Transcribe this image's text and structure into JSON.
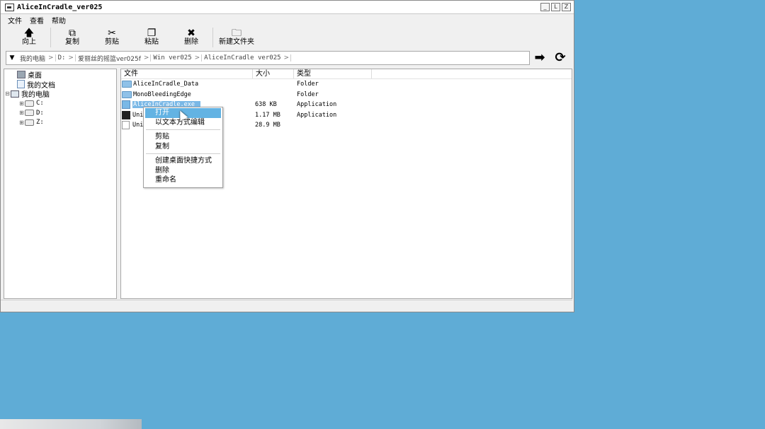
{
  "window": {
    "title": "AliceInCradle_ver025",
    "btn_min": "_",
    "btn_max": "L",
    "btn_close": "Z"
  },
  "menu": [
    "文件",
    "查看",
    "帮助"
  ],
  "toolbar": {
    "up": "向上",
    "copy": "复制",
    "cut": "剪贴",
    "paste": "粘贴",
    "delete": "删除",
    "new_folder": "新建文件夹"
  },
  "address": {
    "crumbs": [
      "我的电脑",
      "D:",
      "爱丽丝的摇篮ver025f",
      "Win ver025",
      "AliceInCradle ver025"
    ]
  },
  "tree": {
    "desktop": "桌面",
    "documents": "我的文档",
    "computer": "我的电脑",
    "drives": [
      "C:",
      "D:",
      "Z:"
    ]
  },
  "columns": {
    "name": "文件",
    "size": "大小",
    "type": "类型"
  },
  "files": [
    {
      "name": "AliceInCradle_Data",
      "size": "",
      "type": "Folder"
    },
    {
      "name": "MonoBleedingEdge",
      "size": "",
      "type": "Folder"
    },
    {
      "name": "AliceInCradle.exe",
      "size": "638 KB",
      "type": "Application"
    },
    {
      "name": "Uni",
      "size": "1.17 MB",
      "type": "Application"
    },
    {
      "name": "Uni",
      "size": "28.9 MB",
      "type": ""
    }
  ],
  "context_menu": {
    "open": "打开",
    "edit_text": "以文本方式编辑",
    "cut": "剪贴",
    "copy": "复制",
    "shortcut": "创建桌面快捷方式",
    "delete": "删除",
    "rename": "重命名"
  }
}
